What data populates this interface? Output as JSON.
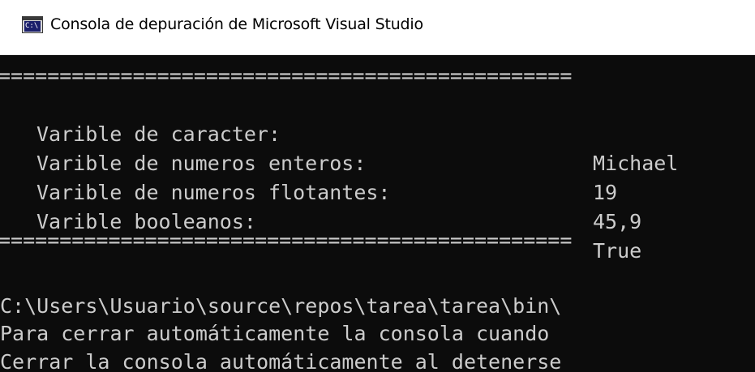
{
  "window": {
    "title": "Consola de depuración de Microsoft Visual Studio",
    "icon": "console-app-icon",
    "icon_glyph": "C:\\"
  },
  "console": {
    "separator_top": "===============================================",
    "rows": [
      {
        "label": "Varible de caracter:",
        "value": "Michael"
      },
      {
        "label": "Varible de numeros enteros:",
        "value": "19"
      },
      {
        "label": "Varible de numeros flotantes:",
        "value": "45,9"
      },
      {
        "label": "Varible booleanos:",
        "value": "True"
      }
    ],
    "separator_bottom": "===============================================",
    "output_lines": [
      "C:\\Users\\Usuario\\source\\repos\\tarea\\tarea\\bin\\",
      "Para cerrar automáticamente la consola cuando",
      "Cerrar la consola automáticamente al detenerse"
    ]
  },
  "colors": {
    "titlebar_bg": "#ffffff",
    "console_bg": "#0c0c0c",
    "console_text": "#cccccc"
  }
}
